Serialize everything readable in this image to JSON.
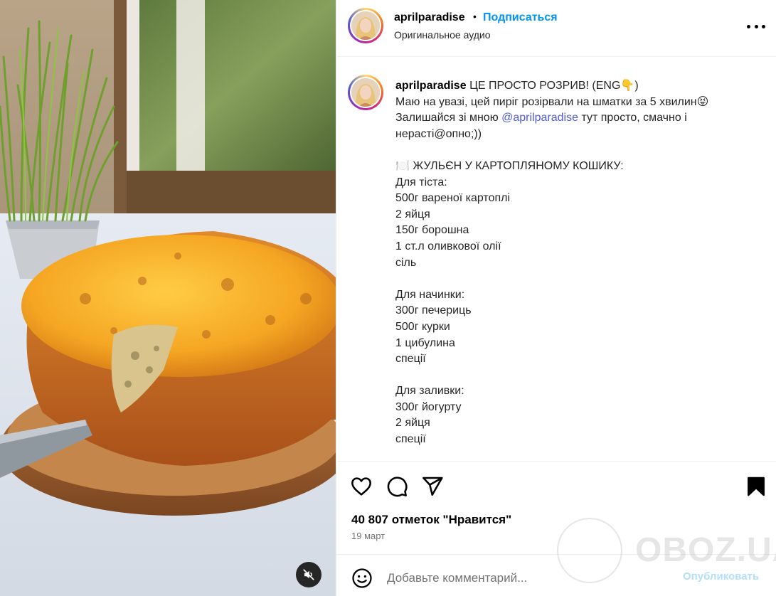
{
  "post": {
    "username": "aprilparadise",
    "separator": "•",
    "follow_label": "Подписаться",
    "audio_label": "Оригинальное аудио",
    "more_label": "..."
  },
  "caption": {
    "username": "aprilparadise",
    "lines": [
      "ЦЕ ПРОСТО РОЗРИВ! (ENG👇)",
      "Маю на увазі, цей пиріг розірвали на шматки за 5 хвилин😝",
      "",
      "нерасті@опно;))",
      "",
      "🍽️ ЖУЛЬЄН У КАРТОПЛЯНОМУ КОШИКУ:",
      "Для тіста:",
      "500г вареної картоплі",
      "2 яйця",
      "150г борошна",
      "1 ст.л оливкової олії",
      "сіль",
      "",
      "Для начинки:",
      "300г печериць",
      "500г курки",
      "1 цибулина",
      "спеції",
      "",
      "Для заливки:",
      "300г йогурту",
      "2 яйця",
      "спеції"
    ],
    "line3_before": "Залишайся зі мною ",
    "line3_mention": "@aprilparadise",
    "line3_after": " тут просто, смачно і"
  },
  "engagement": {
    "likes": "40 807 отметок \"Нравится\"",
    "date": "19 март"
  },
  "comment": {
    "placeholder": "Добавьте комментарий...",
    "publish_label": "Опубликовать"
  },
  "watermark": {
    "text": "OBOZ.UA"
  },
  "icons": {
    "like": "heart-icon",
    "comment": "comment-icon",
    "share": "share-icon",
    "save": "bookmark-icon",
    "emoji": "emoji-icon",
    "mute": "muted-speaker-icon",
    "more": "more-dots-icon"
  },
  "colors": {
    "follow": "#0095f6",
    "mention": "#4f5bd5",
    "publish_disabled": "#b2dffc",
    "secondary_text": "#737373"
  }
}
